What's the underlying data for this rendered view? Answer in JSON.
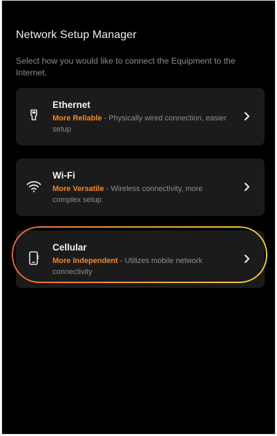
{
  "page": {
    "title": "Network Setup Manager",
    "subtitle": "Select how you would like to connect the Equipment to the Internet."
  },
  "options": [
    {
      "name": "Ethernet",
      "highlight": "More Reliable",
      "description": " - Physically wired connection, easier setup",
      "icon": "ethernet-plug-icon"
    },
    {
      "name": "Wi-Fi",
      "highlight": "More Versatile",
      "description": " - Wireless connectivity, more complex setup",
      "icon": "wifi-icon"
    },
    {
      "name": "Cellular",
      "highlight": "More Independent",
      "description": " - Utilizes mobile network connectivity",
      "icon": "mobile-phone-icon"
    }
  ],
  "colors": {
    "background": "#000000",
    "card": "#1b1b1b",
    "accent": "#f08a2c",
    "ring_start": "#ef6a3a",
    "ring_end": "#f3d13a"
  }
}
